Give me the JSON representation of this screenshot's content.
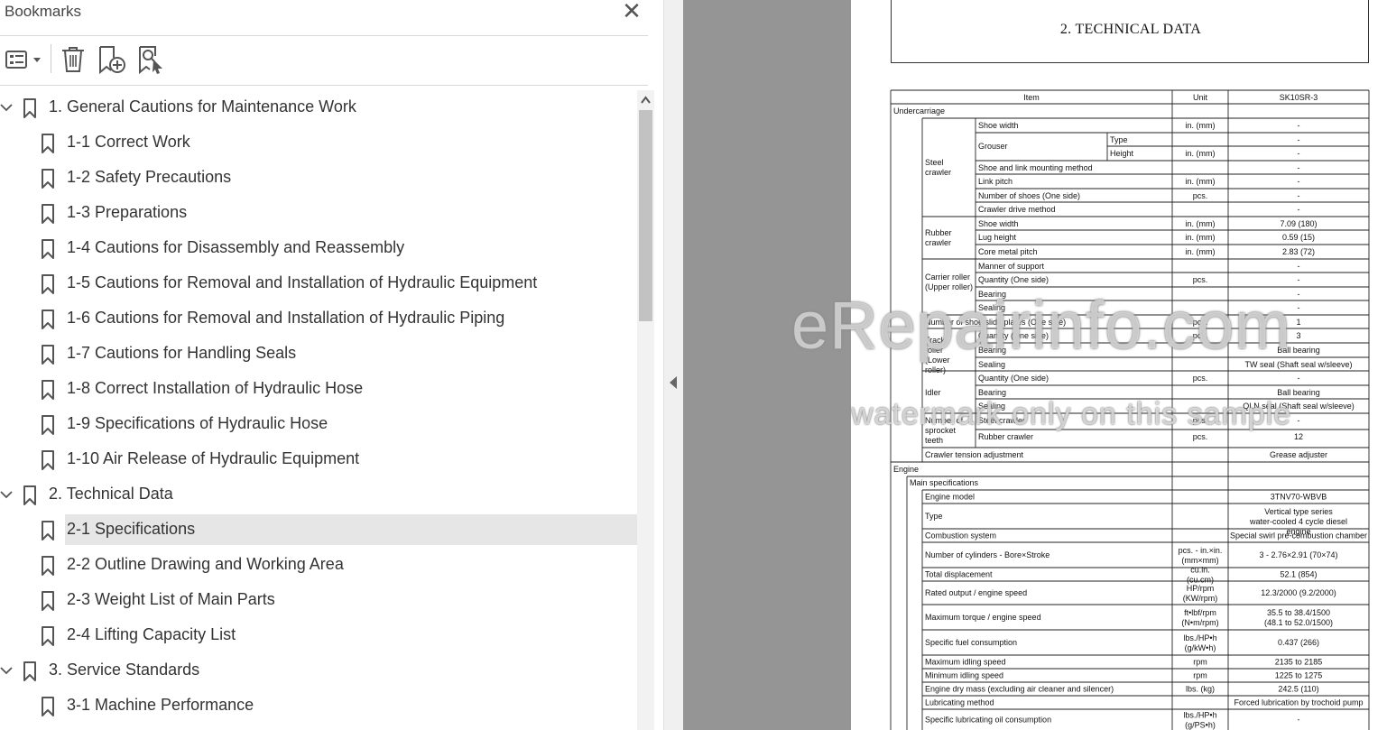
{
  "bookmarks_panel": {
    "title": "Bookmarks",
    "close_icon": "close-icon",
    "toolbar": [
      {
        "icon": "options-list-icon"
      },
      {
        "icon": "trash-icon"
      },
      {
        "icon": "add-bookmark-icon"
      },
      {
        "icon": "find-bookmark-icon"
      }
    ],
    "items": [
      {
        "label": "1. General Cautions for Maintenance Work",
        "level": 0,
        "expanded": true
      },
      {
        "label": "1-1 Correct Work",
        "level": 1
      },
      {
        "label": "1-2 Safety Precautions",
        "level": 1
      },
      {
        "label": "1-3 Preparations",
        "level": 1
      },
      {
        "label": "1-4 Cautions for Disassembly and Reassembly",
        "level": 1
      },
      {
        "label": "1-5 Cautions for Removal and Installation of Hydraulic Equipment",
        "level": 1
      },
      {
        "label": "1-6 Cautions for Removal and Installation of Hydraulic Piping",
        "level": 1
      },
      {
        "label": "1-7 Cautions for Handling Seals",
        "level": 1
      },
      {
        "label": "1-8 Correct Installation of Hydraulic Hose",
        "level": 1
      },
      {
        "label": "1-9 Specifications of Hydraulic Hose",
        "level": 1
      },
      {
        "label": "1-10 Air Release of Hydraulic Equipment",
        "level": 1
      },
      {
        "label": "2. Technical Data",
        "level": 0,
        "expanded": true
      },
      {
        "label": "2-1 Specifications",
        "level": 1,
        "selected": true
      },
      {
        "label": "2-2 Outline Drawing and Working Area",
        "level": 1
      },
      {
        "label": "2-3 Weight List of Main Parts",
        "level": 1
      },
      {
        "label": "2-4 Lifting Capacity List",
        "level": 1
      },
      {
        "label": "3. Service Standards",
        "level": 0,
        "expanded": true
      },
      {
        "label": "3-1 Machine Performance",
        "level": 1
      }
    ]
  },
  "document": {
    "header_title": "2. TECHNICAL DATA",
    "table_header": {
      "item": "Item",
      "unit": "Unit",
      "model": "SK10SR-3"
    },
    "section_labels": {
      "undercarriage": "Undercarriage",
      "steel_crawler": "Steel crawler",
      "rubber_crawler": "Rubber crawler",
      "carrier_roller": "Carrier roller (Upper roller)",
      "track_roller": "Track roller (Lower roller)",
      "idler": "Idler",
      "sprocket": "Number of sprocket teeth",
      "engine": "Engine",
      "main_specs": "Main specifications",
      "grouser": "Grouser"
    },
    "rows": [
      {
        "item": "Shoe width",
        "unit": "in. (mm)",
        "value": "-"
      },
      {
        "item": "Type",
        "unit": "",
        "value": "-"
      },
      {
        "item": "Height",
        "unit": "in. (mm)",
        "value": "-"
      },
      {
        "item": "Shoe and link mounting method",
        "unit": "",
        "value": "-"
      },
      {
        "item": "Link pitch",
        "unit": "in. (mm)",
        "value": "-"
      },
      {
        "item": "Number of shoes (One side)",
        "unit": "pcs.",
        "value": "-"
      },
      {
        "item": "Crawler drive method",
        "unit": "",
        "value": "-"
      },
      {
        "item": "Shoe width",
        "unit": "in. (mm)",
        "value": "7.09 (180)"
      },
      {
        "item": "Lug height",
        "unit": "in. (mm)",
        "value": "0.59 (15)"
      },
      {
        "item": "Core metal pitch",
        "unit": "in. (mm)",
        "value": "2.83 (72)"
      },
      {
        "item": "Manner of support",
        "unit": "",
        "value": "-"
      },
      {
        "item": "Quantity (One side)",
        "unit": "pcs.",
        "value": "-"
      },
      {
        "item": "Bearing",
        "unit": "",
        "value": "-"
      },
      {
        "item": "Sealing",
        "unit": "",
        "value": "-"
      },
      {
        "item": "Number of shoe slide plates (One side)",
        "unit": "pcs.",
        "value": "1"
      },
      {
        "item": "Quantity (One side)",
        "unit": "pcs.",
        "value": "3"
      },
      {
        "item": "Bearing",
        "unit": "",
        "value": "Ball bearing"
      },
      {
        "item": "Sealing",
        "unit": "",
        "value": "TW seal (Shaft seal w/sleeve)"
      },
      {
        "item": "Quantity (One side)",
        "unit": "pcs.",
        "value": "-"
      },
      {
        "item": "Bearing",
        "unit": "",
        "value": "Ball bearing"
      },
      {
        "item": "Sealing",
        "unit": "",
        "value": "QLN seal (Shaft seal w/sleeve)"
      },
      {
        "item": "Steel crawler",
        "unit": "pcs.",
        "value": "-"
      },
      {
        "item": "Rubber crawler",
        "unit": "pcs.",
        "value": "12"
      },
      {
        "item": "Crawler tension adjustment",
        "unit": "",
        "value": "Grease adjuster"
      },
      {
        "item": "Engine model",
        "unit": "",
        "value": "3TNV70-WBVB"
      },
      {
        "item": "Type",
        "unit": "",
        "value": "Vertical type series water-cooled 4 cycle diesel engine"
      },
      {
        "item": "Combustion system",
        "unit": "",
        "value": "Special swirl pre-combustion chamber"
      },
      {
        "item": "Number of cylinders - Bore×Stroke",
        "unit": "pcs. - in.×in. (mm×mm)",
        "value": "3 - 2.76×2.91 (70×74)"
      },
      {
        "item": "Total displacement",
        "unit": "cu.in. (cu.cm)",
        "value": "52.1 (854)"
      },
      {
        "item": "Rated output / engine speed",
        "unit": "HP/rpm (KW/rpm)",
        "value": "12.3/2000 (9.2/2000)"
      },
      {
        "item": "Maximum torque / engine speed",
        "unit": "ft•lbf/rpm (N•m/rpm)",
        "value": "35.5 to 38.4/1500 (48.1 to 52.0/1500)"
      },
      {
        "item": "Specific fuel consumption",
        "unit": "lbs./HP•h (g/kW•h)",
        "value": "0.437 (266)"
      },
      {
        "item": "Maximum idling speed",
        "unit": "rpm",
        "value": "2135 to 2185"
      },
      {
        "item": "Minimum idling speed",
        "unit": "rpm",
        "value": "1225 to 1275"
      },
      {
        "item": "Engine dry mass (excluding air cleaner and silencer)",
        "unit": "lbs. (kg)",
        "value": "242.5 (110)"
      },
      {
        "item": "Lubricating method",
        "unit": "",
        "value": "Forced lubrication by trochoid pump"
      },
      {
        "item": "Specific lubricating oil consumption",
        "unit": "lbs./HP•h (g/PS•h)",
        "value": "-"
      }
    ],
    "watermark": "eRepairinfo.com",
    "watermark_sub": "watermark only on this sample"
  }
}
